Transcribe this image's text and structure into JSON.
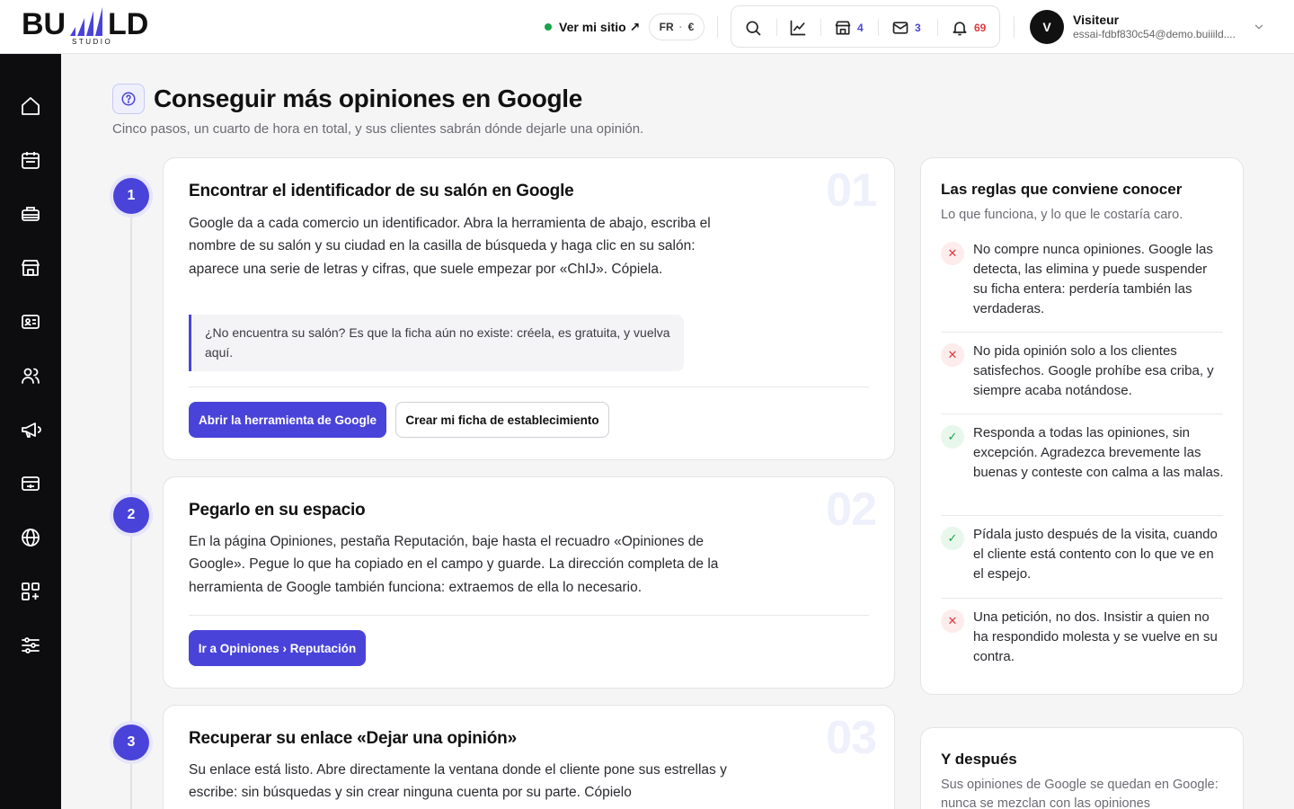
{
  "brand": {
    "logo_text": "BUILD",
    "logo_sub": "STUDIO"
  },
  "header": {
    "site_link": "Ver mi sitio ↗",
    "lang": "FR",
    "currency": "€",
    "shop_count": "4",
    "mail_count": "3",
    "notif_count": "69",
    "user_initial": "V",
    "user_name": "Visiteur",
    "user_email": "essai-fdbf830c54@demo.buiiild...."
  },
  "sidebar": {
    "items": [
      "home-icon",
      "calendar-icon",
      "services-icon",
      "shop-icon",
      "contact-card-icon",
      "users-icon",
      "megaphone-icon",
      "billing-icon",
      "globe-icon",
      "apps-icon",
      "settings-sliders-icon"
    ]
  },
  "page": {
    "title": "Conseguir más opiniones en Google",
    "subtitle": "Cinco pasos, un cuarto de hora en total, y sus clientes sabrán dónde dejarle una opinión."
  },
  "steps": [
    {
      "num": "1",
      "big": "01",
      "title": "Encontrar el identificador de su salón en Google",
      "body": "Google da a cada comercio un identificador. Abra la herramienta de abajo, escriba el nombre de su salón y su ciudad en la casilla de búsqueda y haga clic en su salón: aparece una serie de letras y cifras, que suele empezar por «ChIJ». Cópiela.",
      "callout": "¿No encuentra su salón? Es que la ficha aún no existe: créela, es gratuita, y vuelva aquí.",
      "btn_primary": "Abrir la herramienta de Google",
      "btn_secondary": "Crear mi ficha de establecimiento"
    },
    {
      "num": "2",
      "big": "02",
      "title": "Pegarlo en su espacio",
      "body": "En la página Opiniones, pestaña Reputación, baje hasta el recuadro «Opiniones de Google». Pegue lo que ha copiado en el campo y guarde. La dirección completa de la herramienta de Google también funciona: extraemos de ella lo necesario.",
      "btn_primary": "Ir a Opiniones › Reputación"
    },
    {
      "num": "3",
      "big": "03",
      "title": "Recuperar su enlace «Dejar una opinión»",
      "body": "Su enlace está listo. Abre directamente la ventana donde el cliente pone sus estrellas y escribe: sin búsquedas y sin crear ninguna cuenta por su parte. Cópielo"
    }
  ],
  "rules": {
    "title": "Las reglas que conviene conocer",
    "subtitle": "Lo que funciona, y lo que le costaría caro.",
    "items": [
      {
        "type": "bad",
        "symbol": "✕",
        "text": "No compre nunca opiniones. Google las detecta, las elimina y puede suspender su ficha entera: perdería también las verdaderas."
      },
      {
        "type": "bad",
        "symbol": "✕",
        "text": "No pida opinión solo a los clientes satisfechos. Google prohíbe esa criba, y siempre acaba notándose."
      },
      {
        "type": "good",
        "symbol": "✓",
        "text": "Responda a todas las opiniones, sin excepción. Agradezca brevemente las buenas y conteste con calma a las malas."
      },
      {
        "type": "good",
        "symbol": "✓",
        "text": "Pídala justo después de la visita, cuando el cliente está contento con lo que ve en el espejo."
      },
      {
        "type": "bad",
        "symbol": "✕",
        "text": "Una petición, no dos. Insistir a quien no ha respondido molesta y se vuelve en su contra."
      }
    ]
  },
  "after": {
    "title": "Y después",
    "subtitle": "Sus opiniones de Google se quedan en Google: nunca se mezclan con las opiniones"
  },
  "colors": {
    "accent": "#4a43d9",
    "bad": "#e0393e",
    "good": "#16a34a",
    "online": "#16a34a"
  }
}
